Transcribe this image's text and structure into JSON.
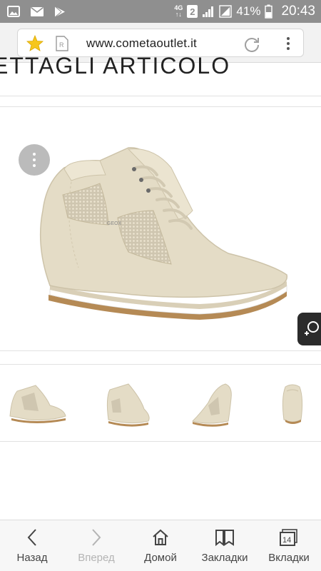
{
  "status_bar": {
    "network_type": "4G",
    "sim_badge": "2",
    "battery_percent": "41%",
    "time": "20:43",
    "left_icons": [
      "gallery-icon",
      "mail-icon",
      "play-store-icon"
    ],
    "right_icons": [
      "signal-icon",
      "signal-icon-2",
      "battery-icon"
    ]
  },
  "browser": {
    "url": "www.cometaoutlet.it",
    "reader_badge": "R"
  },
  "page": {
    "heading": "ETTAGLI ARTICOLO",
    "brand_on_shoe": "GEOX"
  },
  "bottom_nav": {
    "items": [
      {
        "label": "Назад",
        "icon": "back-arrow-icon",
        "enabled": true
      },
      {
        "label": "Вперед",
        "icon": "forward-arrow-icon",
        "enabled": false
      },
      {
        "label": "Домой",
        "icon": "home-icon",
        "enabled": true
      },
      {
        "label": "Закладки",
        "icon": "bookmarks-icon",
        "enabled": true
      },
      {
        "label": "Вкладки",
        "icon": "tabs-icon",
        "enabled": true,
        "count": "14"
      }
    ]
  },
  "colors": {
    "status_bar": "#8f8f8f",
    "shoe_suede": "#e4dcc6",
    "star": "#f6c61c"
  }
}
